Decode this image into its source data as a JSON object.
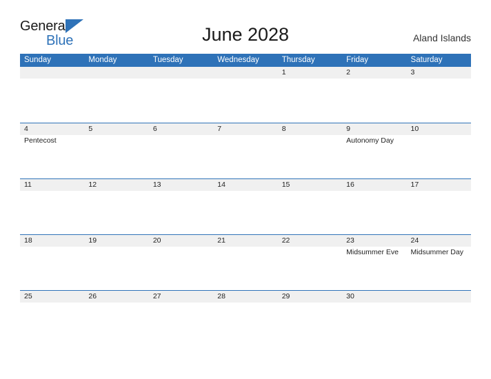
{
  "brand": {
    "name_part1": "General",
    "name_part2": "Blue",
    "triangle_icon": "triangle-icon",
    "primary_color": "#2e72b8"
  },
  "header": {
    "title": "June 2028",
    "region": "Aland Islands"
  },
  "calendar": {
    "weekday_headers": [
      "Sunday",
      "Monday",
      "Tuesday",
      "Wednesday",
      "Thursday",
      "Friday",
      "Saturday"
    ],
    "header_bg": "#2e72b8",
    "band_bg": "#f0f0f0",
    "rows": [
      [
        {
          "date": "",
          "events": []
        },
        {
          "date": "",
          "events": []
        },
        {
          "date": "",
          "events": []
        },
        {
          "date": "",
          "events": []
        },
        {
          "date": "1",
          "events": []
        },
        {
          "date": "2",
          "events": []
        },
        {
          "date": "3",
          "events": []
        }
      ],
      [
        {
          "date": "4",
          "events": [
            "Pentecost"
          ]
        },
        {
          "date": "5",
          "events": []
        },
        {
          "date": "6",
          "events": []
        },
        {
          "date": "7",
          "events": []
        },
        {
          "date": "8",
          "events": []
        },
        {
          "date": "9",
          "events": [
            "Autonomy Day"
          ]
        },
        {
          "date": "10",
          "events": []
        }
      ],
      [
        {
          "date": "11",
          "events": []
        },
        {
          "date": "12",
          "events": []
        },
        {
          "date": "13",
          "events": []
        },
        {
          "date": "14",
          "events": []
        },
        {
          "date": "15",
          "events": []
        },
        {
          "date": "16",
          "events": []
        },
        {
          "date": "17",
          "events": []
        }
      ],
      [
        {
          "date": "18",
          "events": []
        },
        {
          "date": "19",
          "events": []
        },
        {
          "date": "20",
          "events": []
        },
        {
          "date": "21",
          "events": []
        },
        {
          "date": "22",
          "events": []
        },
        {
          "date": "23",
          "events": [
            "Midsummer Eve"
          ]
        },
        {
          "date": "24",
          "events": [
            "Midsummer Day"
          ]
        }
      ],
      [
        {
          "date": "25",
          "events": []
        },
        {
          "date": "26",
          "events": []
        },
        {
          "date": "27",
          "events": []
        },
        {
          "date": "28",
          "events": []
        },
        {
          "date": "29",
          "events": []
        },
        {
          "date": "30",
          "events": []
        },
        {
          "date": "",
          "events": []
        }
      ]
    ]
  }
}
